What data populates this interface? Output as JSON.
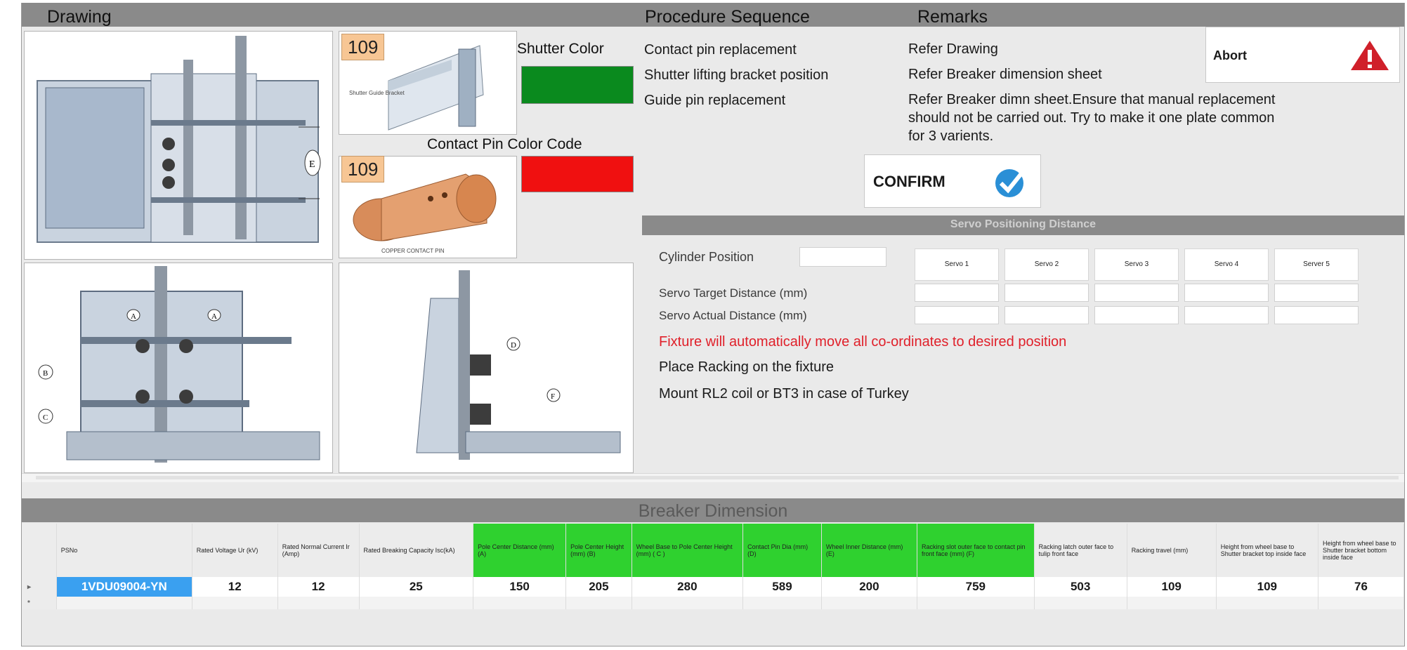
{
  "headers": {
    "drawing": "Drawing",
    "procedure": "Procedure Sequence",
    "remarks": "Remarks"
  },
  "left": {
    "badge1": "109",
    "badge2": "109",
    "shutter_color_label": "Shutter Color",
    "contact_pin_label": "Contact Pin Color Code",
    "shutter_color": "#0a8a1e",
    "contact_pin_color": "#f01010",
    "img1_caption": "Shutter Guide Bracket",
    "img2_caption": "COPPER CONTACT PIN",
    "dim_labels": {
      "e": "E",
      "a1": "A",
      "a2": "A",
      "b": "B",
      "c": "C",
      "d": "D",
      "f": "F"
    }
  },
  "procedure": {
    "items": [
      "Contact pin replacement",
      "Shutter lifting bracket position",
      "Guide pin replacement"
    ]
  },
  "remarks": {
    "items": [
      "Refer  Drawing",
      "Refer Breaker dimension sheet",
      "Refer Breaker dimn sheet.Ensure that manual replacement",
      "should not be carried out. Try to make it one plate common",
      "for 3 varients."
    ]
  },
  "abort": {
    "label": "Abort",
    "icon": "warning-icon",
    "icon_color": "#d0202a"
  },
  "confirm": {
    "label": "CONFIRM",
    "icon": "check-icon",
    "icon_color": "#2a8fd6"
  },
  "servo": {
    "title": "Servo Positioning Distance",
    "cylinder_label": "Cylinder Position",
    "target_label": "Servo Target Distance (mm)",
    "actual_label": "Servo Actual Distance (mm)",
    "buttons": [
      "Servo 1",
      "Servo 2",
      "Servo 3",
      "Servo 4",
      "Server 5"
    ]
  },
  "notes": {
    "warning": "Fixture will automatically move all co-ordinates to desired position",
    "warning_color": "#e0202a",
    "n1": "Place Racking on the fixture",
    "n2": "Mount RL2 coil or BT3 in case of Turkey"
  },
  "breaker": {
    "title": "Breaker Dimension",
    "columns": [
      "PSNo",
      "Rated Voltage Ur (kV)",
      "Rated Normal Current Ir (Amp)",
      "Rated Breaking Capacity Isc(kA)",
      "Pole Center Distance (mm) (A)",
      "Pole Center Height (mm) (B)",
      "Wheel Base to Pole Center Height (mm) ( C )",
      "Contact Pin Dia (mm) (D)",
      "Wheel Inner Distance (mm) (E)",
      "Racking slot outer face to contact pin front face (mm) (F)",
      "Racking latch outer face to tulip front face",
      "Racking travel (mm)",
      "Height from wheel base to Shutter bracket top inside face",
      "Height from wheel base to Shutter bracket bottom inside face"
    ],
    "row": [
      "1VDU09004-YN",
      "12",
      "12",
      "25",
      "150",
      "205",
      "280",
      "589",
      "200",
      "759",
      "503",
      "109",
      "109",
      "76"
    ],
    "row_marker": "▸",
    "new_marker": "*"
  }
}
